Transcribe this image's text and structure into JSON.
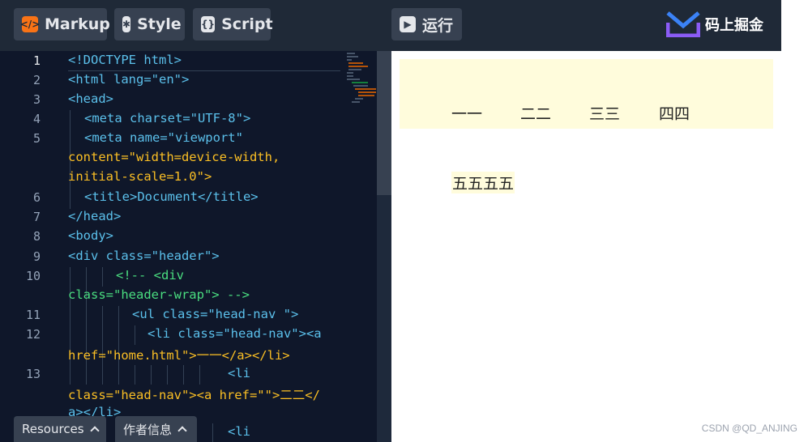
{
  "toolbar": {
    "tabs": [
      {
        "label": "Markup",
        "icon": "code-icon"
      },
      {
        "label": "Style",
        "icon": "asterisk-icon"
      },
      {
        "label": "Script",
        "icon": "braces-icon"
      }
    ],
    "run_label": "运行",
    "brand": "码上掘金"
  },
  "editor": {
    "line_numbers": [
      "1",
      "2",
      "3",
      "4",
      "5",
      "6",
      "7",
      "8",
      "9",
      "10",
      "11",
      "12",
      "13"
    ],
    "lines": [
      "<!DOCTYPE html>",
      "<html lang=\"en\">",
      "<head>",
      "<meta charset=\"UTF-8\">",
      "<meta name=\"viewport\"",
      "content=\"width=device-width,",
      "initial-scale=1.0\">",
      "<title>Document</title>",
      "</head>",
      "<body>",
      "<div class=\"header\">",
      "<!-- <div",
      "class=\"header-wrap\"> -->",
      "<ul class=\"head-nav \">",
      "<li class=\"head-nav\"><a",
      "href=\"home.html\">一一</a></li>",
      "<li",
      "class=\"head-nav\"><a href=\"\">二二</",
      "a></li>",
      "<li"
    ]
  },
  "bottom": {
    "resources_label": "Resources",
    "author_label": "作者信息"
  },
  "preview": {
    "nav": [
      "一一",
      "二二",
      "三三",
      "四四"
    ],
    "item5": "五五五五"
  },
  "watermark": "CSDN @QD_ANJING",
  "colors": {
    "toolbar_bg": "#1f2937",
    "editor_bg": "#0f172a",
    "tag": "#5bc0eb",
    "attr_value": "#fbbf24",
    "comment": "#4ade80",
    "highlight": "#fffcdc"
  }
}
